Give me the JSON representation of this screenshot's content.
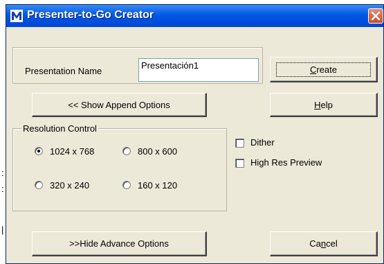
{
  "window": {
    "title": "Presenter-to-Go Creator",
    "icon": "app-m-icon",
    "close_icon": "close-x-icon",
    "colors": {
      "titlebar": "#0058E6",
      "close": "#D6502F",
      "face": "#ECE9D8"
    }
  },
  "presentation": {
    "name_label": "Presentation Name",
    "name_value": "Presentación1"
  },
  "buttons": {
    "create": {
      "pre": "",
      "accel": "C",
      "post": "reate"
    },
    "show_append": "<< Show Append Options",
    "help": {
      "pre": "",
      "accel": "H",
      "post": "elp"
    },
    "hide_advance": ">>Hide Advance Options",
    "cancel": {
      "pre": "Ca",
      "accel": "n",
      "post": "cel"
    }
  },
  "resolution": {
    "legend": "Resolution Control",
    "options": [
      {
        "label": "1024 x 768",
        "selected": true
      },
      {
        "label": "800 x 600",
        "selected": false
      },
      {
        "label": "320 x 240",
        "selected": false
      },
      {
        "label": "160 x 120",
        "selected": false
      }
    ]
  },
  "checkboxes": [
    {
      "label": "Dither",
      "checked": false
    },
    {
      "label": "High Res Preview",
      "checked": false
    }
  ]
}
